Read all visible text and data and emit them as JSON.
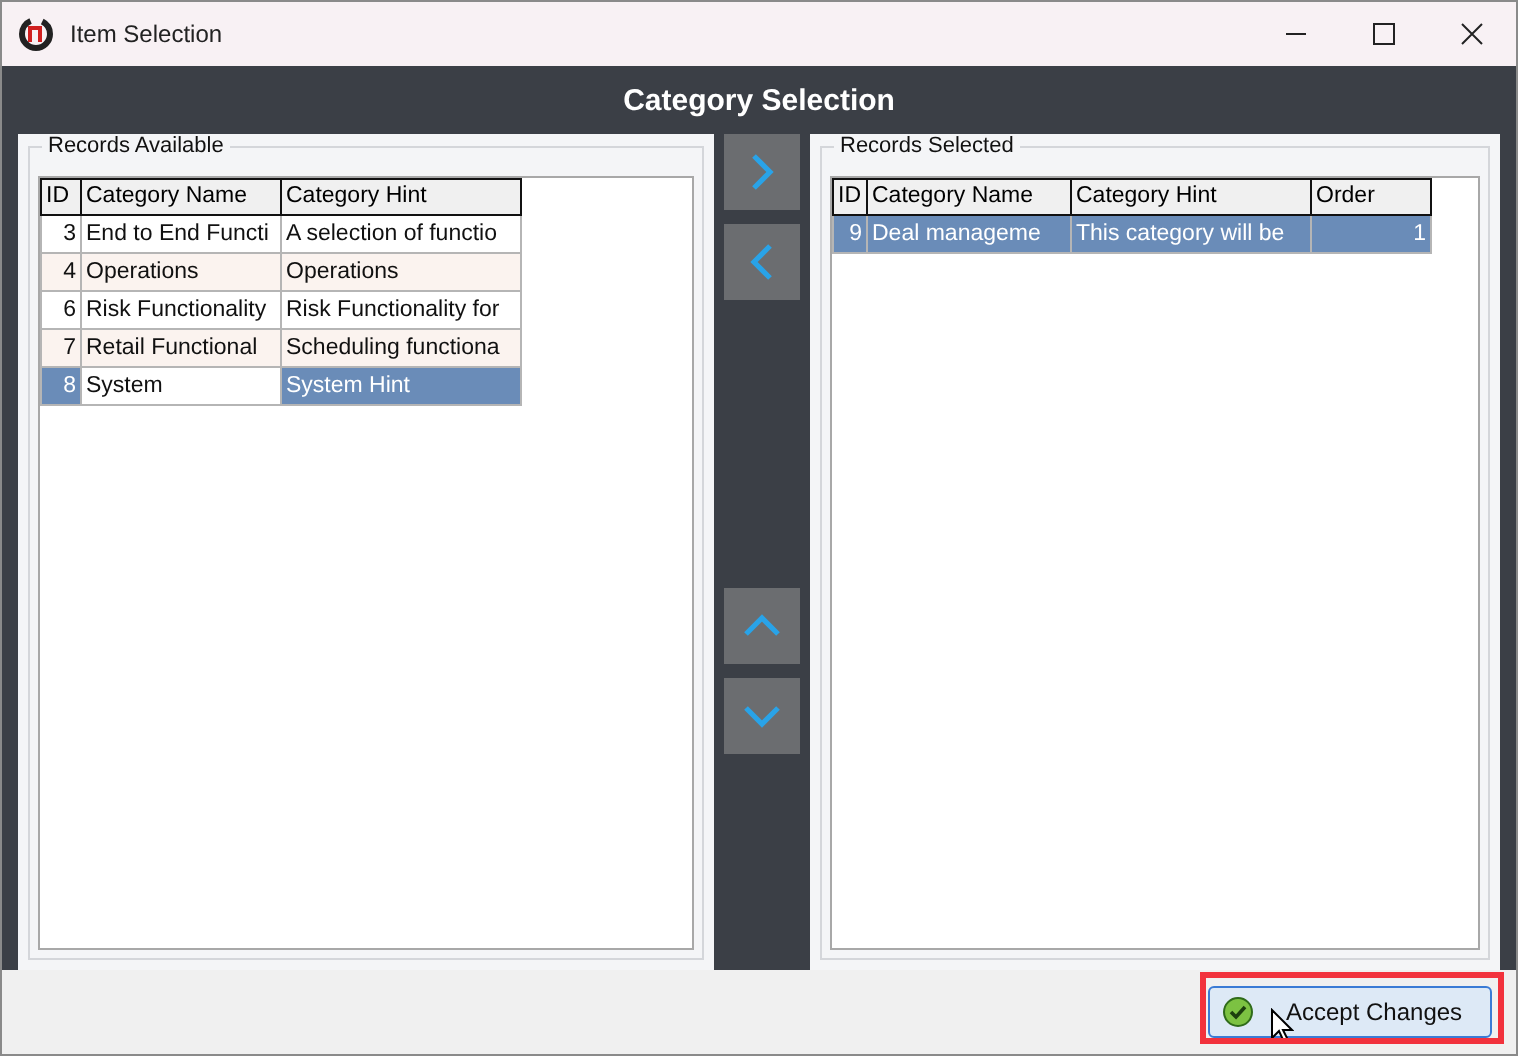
{
  "window": {
    "title": "Item Selection"
  },
  "header": "Category Selection",
  "available": {
    "title": "Records Available",
    "columns": [
      "ID",
      "Category Name",
      "Category Hint"
    ],
    "rows": [
      {
        "cells": [
          "3",
          "End to End Functi",
          "A selection of functio"
        ],
        "selected": false
      },
      {
        "cells": [
          "4",
          "Operations",
          "Operations"
        ],
        "selected": false
      },
      {
        "cells": [
          "6",
          "Risk Functionality",
          "Risk Functionality for"
        ],
        "selected": false
      },
      {
        "cells": [
          "7",
          "Retail Functional",
          "Scheduling functiona"
        ],
        "selected": false
      },
      {
        "cells": [
          "8",
          "System",
          "System Hint"
        ],
        "selected": true,
        "name_cell_focused": true
      }
    ]
  },
  "selected_records": {
    "title": "Records Selected",
    "columns": [
      "ID",
      "Category Name",
      "Category Hint",
      "Order"
    ],
    "rows": [
      {
        "cells": [
          "9",
          "Deal manageme",
          "This category will be",
          "1"
        ],
        "selected": true
      }
    ]
  },
  "accept_button": {
    "label": "Accept Changes",
    "highlighted": true
  }
}
